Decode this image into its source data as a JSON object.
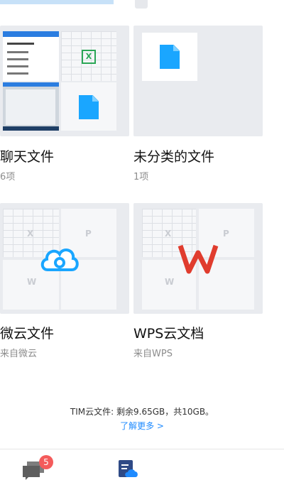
{
  "cards": [
    {
      "title": "聊天文件",
      "subtitle": "6项"
    },
    {
      "title": "未分类的文件",
      "subtitle": "1项"
    },
    {
      "title": "微云文件",
      "subtitle": "来自微云"
    },
    {
      "title": "WPS云文档",
      "subtitle": "来自WPS"
    }
  ],
  "storage": {
    "line": "TIM云文件: 剩余9.65GB，共10GB。",
    "link": "了解更多 >"
  },
  "tabbar": {
    "messages_badge": "5",
    "messages_icon": "chat-bubbles-icon",
    "files_icon": "files-cloud-icon"
  },
  "colors": {
    "accent_blue": "#1f8bff",
    "badge_red": "#f45b5b",
    "wps_red": "#e03c2e",
    "weiyun_blue": "#1aa6ff"
  }
}
